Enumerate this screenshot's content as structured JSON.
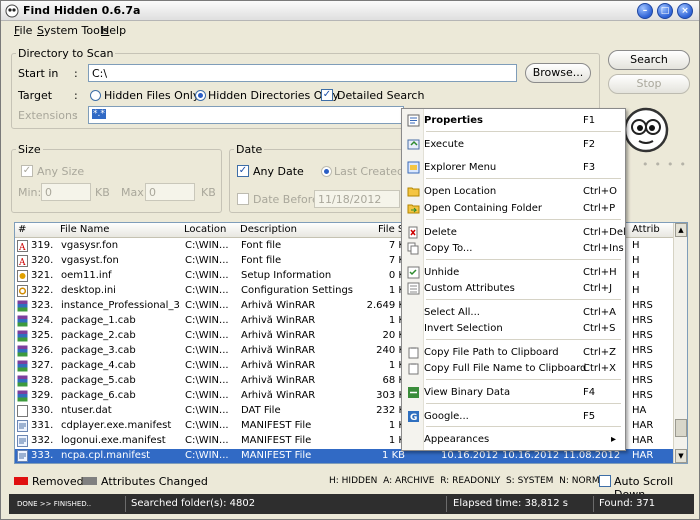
{
  "window": {
    "title": "Find Hidden 0.6.7a"
  },
  "menubar": {
    "items": [
      "File",
      "System Tools",
      "Help"
    ]
  },
  "scan": {
    "group_label": "Directory to Scan",
    "start_in_label": "Start in",
    "colon": ":",
    "start_in_value": "C:\\",
    "browse_label": "Browse...",
    "target_label": "Target",
    "hidden_files_label": "Hidden Files Only",
    "hidden_dirs_label": "Hidden Directories Only",
    "detailed_label": "Detailed Search",
    "extensions_label": "Extensions",
    "extensions_value": "*.*",
    "target_selected": "Hidden Directories Only",
    "detailed_checked": true
  },
  "actions": {
    "search_label": "Search",
    "stop_label": "Stop"
  },
  "size": {
    "group_label": "Size",
    "any_size_label": "Any Size",
    "min_label": "Min:",
    "min_value": "0",
    "max_label": "Max:",
    "max_value": "0",
    "unit": "KB"
  },
  "date": {
    "group_label": "Date",
    "any_date_label": "Any Date",
    "last_created_label": "Last Created",
    "date_before_label": "Date Before",
    "date_before_value": "11/18/2012"
  },
  "table": {
    "columns": [
      "#",
      "File Name",
      "Location",
      "Description",
      "File Si",
      "Attrib"
    ],
    "rows": [
      {
        "num": "319.",
        "name": "vgasysr.fon",
        "loc": "C:\\WIN...",
        "desc": "Font file",
        "size": "7 K",
        "attr": "H",
        "icon": "font"
      },
      {
        "num": "320.",
        "name": "vgasyst.fon",
        "loc": "C:\\WIN...",
        "desc": "Font file",
        "size": "7 K",
        "attr": "H",
        "icon": "font"
      },
      {
        "num": "321.",
        "name": "oem11.inf",
        "loc": "C:\\WIN...",
        "desc": "Setup Information",
        "size": "0 K",
        "attr": "H",
        "icon": "inf"
      },
      {
        "num": "322.",
        "name": "desktop.ini",
        "loc": "C:\\WIN...",
        "desc": "Configuration Settings",
        "size": "1 K",
        "attr": "H",
        "icon": "ini"
      },
      {
        "num": "323.",
        "name": "instance_Professional_3...",
        "loc": "C:\\WIN...",
        "desc": "Arhivă WinRAR",
        "size": "2.649 K",
        "attr": "HRS",
        "icon": "rar"
      },
      {
        "num": "324.",
        "name": "package_1.cab",
        "loc": "C:\\WIN...",
        "desc": "Arhivă WinRAR",
        "size": "1 K",
        "attr": "HRS",
        "icon": "rar"
      },
      {
        "num": "325.",
        "name": "package_2.cab",
        "loc": "C:\\WIN...",
        "desc": "Arhivă WinRAR",
        "size": "20 K",
        "attr": "HRS",
        "icon": "rar"
      },
      {
        "num": "326.",
        "name": "package_3.cab",
        "loc": "C:\\WIN...",
        "desc": "Arhivă WinRAR",
        "size": "240 K",
        "attr": "HRS",
        "icon": "rar"
      },
      {
        "num": "327.",
        "name": "package_4.cab",
        "loc": "C:\\WIN...",
        "desc": "Arhivă WinRAR",
        "size": "1 K",
        "attr": "HRS",
        "icon": "rar"
      },
      {
        "num": "328.",
        "name": "package_5.cab",
        "loc": "C:\\WIN...",
        "desc": "Arhivă WinRAR",
        "size": "68 K",
        "attr": "HRS",
        "icon": "rar"
      },
      {
        "num": "329.",
        "name": "package_6.cab",
        "loc": "C:\\WIN...",
        "desc": "Arhivă WinRAR",
        "size": "303 K",
        "attr": "HRS",
        "icon": "rar"
      },
      {
        "num": "330.",
        "name": "ntuser.dat",
        "loc": "C:\\WIN...",
        "desc": "DAT File",
        "size": "232 K",
        "attr": "HA",
        "icon": "dat"
      },
      {
        "num": "331.",
        "name": "cdplayer.exe.manifest",
        "loc": "C:\\WIN...",
        "desc": "MANIFEST File",
        "size": "1 K",
        "attr": "HAR",
        "icon": "manifest"
      },
      {
        "num": "332.",
        "name": "logonui.exe.manifest",
        "loc": "C:\\WIN...",
        "desc": "MANIFEST File",
        "size": "1 K",
        "attr": "HAR",
        "icon": "manifest"
      },
      {
        "num": "333.",
        "name": "ncpa.cpl.manifest",
        "loc": "C:\\WIN...",
        "desc": "MANIFEST File",
        "size": "1 KB",
        "created": "10.16.2012",
        "modified": "10.16.2012",
        "accessed": "11.08.2012",
        "attr": "HAR",
        "icon": "manifest",
        "selected": true
      }
    ]
  },
  "legend": {
    "removed_label": "Removed",
    "changed_label": "Attributes Changed",
    "removed_color": "#e01010",
    "changed_color": "#808080",
    "attrs_key": "H: HIDDEN  A: ARCHIVE  R: READONLY  S: SYSTEM  N: NORMAL",
    "autoscroll_label": "Auto Scroll Down"
  },
  "status": {
    "left": "DONE >> FINISHED..",
    "folders": "Searched folder(s): 4802",
    "elapsed": "Elapsed time: 38,812 s",
    "found": "Found: 371"
  },
  "context_menu": {
    "items": [
      {
        "label": "Properties",
        "shortcut": "F1",
        "icon": "properties-icon",
        "bold": true
      },
      {
        "label": "Execute",
        "shortcut": "F2",
        "icon": "execute-icon"
      },
      {
        "label": "Explorer Menu",
        "shortcut": "F3",
        "icon": "explorer-menu-icon"
      },
      {
        "label": "Open Location",
        "shortcut": "Ctrl+O",
        "icon": "folder-icon"
      },
      {
        "label": "Open Containing Folder",
        "shortcut": "Ctrl+P",
        "icon": "folder-arrow-icon"
      },
      {
        "label": "Delete",
        "shortcut": "Ctrl+Del",
        "icon": "delete-icon"
      },
      {
        "label": "Copy To...",
        "shortcut": "Ctrl+Ins",
        "icon": "copy-icon"
      },
      {
        "label": "Unhide",
        "shortcut": "Ctrl+H",
        "icon": "unhide-icon"
      },
      {
        "label": "Custom Attributes",
        "shortcut": "Ctrl+J",
        "icon": "attributes-icon"
      },
      {
        "label": "Select All...",
        "shortcut": "Ctrl+A",
        "icon": "none"
      },
      {
        "label": "Invert Selection",
        "shortcut": "Ctrl+S",
        "icon": "none"
      },
      {
        "label": "Copy File Path to Clipboard",
        "shortcut": "Ctrl+Z",
        "icon": "clipboard-icon"
      },
      {
        "label": "Copy Full File Name to Clipboard",
        "shortcut": "Ctrl+X",
        "icon": "clipboard-icon"
      },
      {
        "label": "View Binary Data",
        "shortcut": "F4",
        "icon": "binary-icon"
      },
      {
        "label": "Google...",
        "shortcut": "F5",
        "icon": "google-icon"
      },
      {
        "label": "Appearances",
        "shortcut": "▸",
        "icon": "none"
      }
    ]
  }
}
